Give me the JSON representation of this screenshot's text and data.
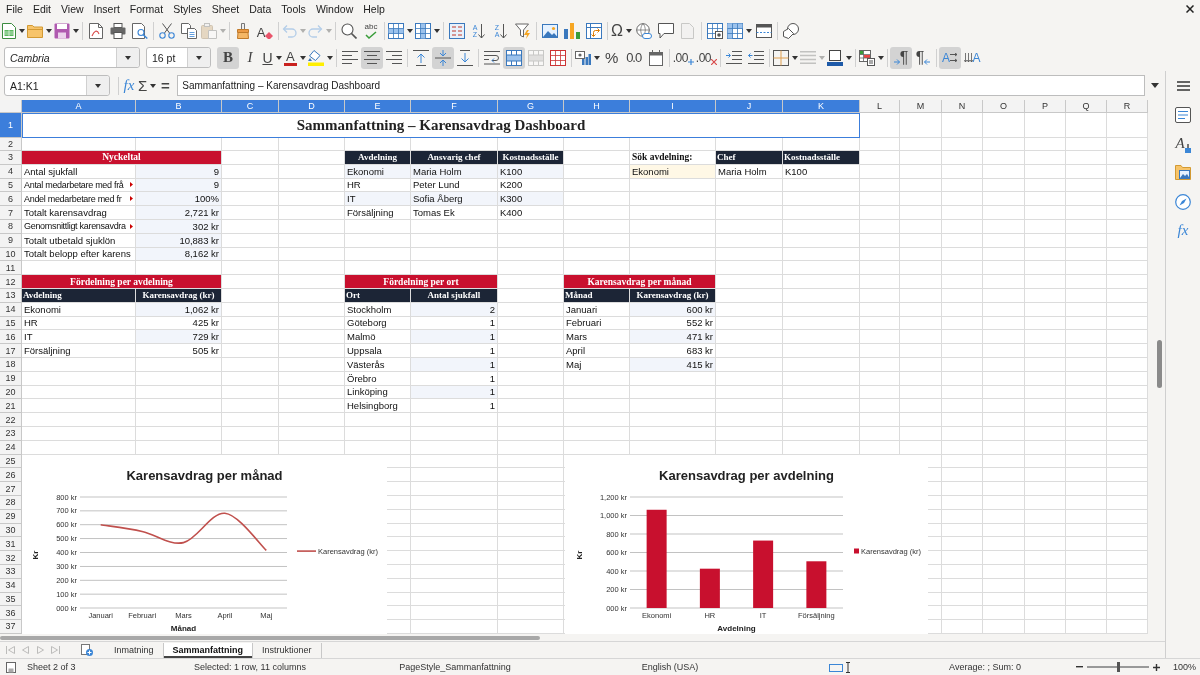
{
  "menu_bar": [
    "File",
    "Edit",
    "View",
    "Insert",
    "Format",
    "Styles",
    "Sheet",
    "Data",
    "Tools",
    "Window",
    "Help"
  ],
  "standard_toolbar": [
    [
      {
        "kind": "new",
        "dropdown": true,
        "disabled": false
      },
      {
        "kind": "open",
        "dropdown": true,
        "disabled": false
      },
      {
        "kind": "save",
        "dropdown": true,
        "disabled": false
      }
    ],
    [
      {
        "kind": "pdf",
        "dropdown": false,
        "disabled": false
      },
      {
        "kind": "print",
        "dropdown": false,
        "disabled": false
      },
      {
        "kind": "preview",
        "dropdown": false,
        "disabled": false
      }
    ],
    [
      {
        "kind": "cut",
        "dropdown": false,
        "disabled": false
      },
      {
        "kind": "copy",
        "dropdown": false,
        "disabled": false
      },
      {
        "kind": "paste",
        "dropdown": true,
        "disabled": true
      }
    ],
    [
      {
        "kind": "clone",
        "dropdown": false,
        "disabled": false
      },
      {
        "kind": "clear",
        "glyph": "A",
        "dropdown": false,
        "disabled": false
      }
    ],
    [
      {
        "kind": "undo",
        "dropdown": true,
        "disabled": true
      },
      {
        "kind": "redo",
        "dropdown": true,
        "disabled": true
      }
    ],
    [
      {
        "kind": "find",
        "dropdown": false,
        "disabled": false
      },
      {
        "kind": "spelling",
        "glyph": "abc",
        "dropdown": false,
        "disabled": false
      }
    ],
    [
      {
        "kind": "rows",
        "dropdown": true,
        "disabled": false
      },
      {
        "kind": "columns",
        "dropdown": true,
        "disabled": false
      }
    ],
    [
      {
        "kind": "sort",
        "dropdown": false,
        "disabled": false
      },
      {
        "kind": "sort_ascending",
        "glyph": "A Z",
        "dropdown": false,
        "disabled": false
      },
      {
        "kind": "sort_descending",
        "glyph": "Z A",
        "dropdown": false,
        "disabled": false
      },
      {
        "kind": "autofilter",
        "dropdown": false,
        "disabled": false
      }
    ],
    [
      {
        "kind": "image",
        "dropdown": false,
        "disabled": false
      },
      {
        "kind": "chart",
        "dropdown": false,
        "disabled": false
      },
      {
        "kind": "pivot_table",
        "dropdown": false,
        "disabled": false
      }
    ],
    [
      {
        "kind": "special_character",
        "glyph": "Ω",
        "dropdown": true,
        "disabled": false
      },
      {
        "kind": "hyperlink",
        "dropdown": false,
        "disabled": false
      },
      {
        "kind": "comment",
        "dropdown": false,
        "disabled": false
      },
      {
        "kind": "headers_footers",
        "dropdown": false,
        "disabled": true
      }
    ],
    [
      {
        "kind": "print_area",
        "dropdown": false,
        "disabled": false
      },
      {
        "kind": "freeze",
        "dropdown": true,
        "disabled": false
      },
      {
        "kind": "split_window",
        "dropdown": false,
        "disabled": false
      }
    ],
    [
      {
        "kind": "shapes",
        "dropdown": false,
        "disabled": false
      }
    ]
  ],
  "formatting_toolbar": {
    "font_name": "Cambria",
    "font_size": "16 pt",
    "groups": [
      [
        {
          "kind": "bold",
          "glyph": "B",
          "dropdown": false,
          "on": true,
          "disabled": false
        },
        {
          "kind": "italic",
          "glyph": "I",
          "dropdown": false,
          "on": false,
          "disabled": false
        },
        {
          "kind": "underline",
          "glyph": "U",
          "dropdown": true,
          "on": false,
          "disabled": false
        },
        {
          "kind": "font_color",
          "glyph": "A",
          "dropdown": true,
          "on": false,
          "disabled": false
        },
        {
          "kind": "highlight",
          "dropdown": true,
          "on": false,
          "disabled": false
        }
      ],
      [
        {
          "kind": "align_left",
          "dropdown": false,
          "on": false,
          "disabled": false
        },
        {
          "kind": "align_center",
          "dropdown": false,
          "on": true,
          "disabled": false
        },
        {
          "kind": "align_right",
          "dropdown": false,
          "on": false,
          "disabled": false
        }
      ],
      [
        {
          "kind": "align_top",
          "dropdown": false,
          "on": false,
          "disabled": false
        },
        {
          "kind": "align_middle",
          "dropdown": false,
          "on": true,
          "disabled": false
        },
        {
          "kind": "align_bottom",
          "dropdown": false,
          "on": false,
          "disabled": false
        }
      ],
      [
        {
          "kind": "wrap",
          "dropdown": false,
          "on": false,
          "disabled": false
        },
        {
          "kind": "merge_center",
          "dropdown": false,
          "on": true,
          "disabled": false
        },
        {
          "kind": "merge",
          "dropdown": false,
          "on": false,
          "disabled": true
        },
        {
          "kind": "unmerge",
          "dropdown": false,
          "on": false,
          "disabled": false
        }
      ],
      [
        {
          "kind": "currency",
          "dropdown": true,
          "on": false,
          "disabled": false
        },
        {
          "kind": "percent",
          "glyph": "%",
          "dropdown": false,
          "on": false,
          "disabled": false
        },
        {
          "kind": "number",
          "glyph": "0.0",
          "dropdown": false,
          "on": false,
          "disabled": false
        },
        {
          "kind": "date",
          "dropdown": false,
          "on": false,
          "disabled": false
        }
      ],
      [
        {
          "kind": "add_decimal",
          "glyph": ".00",
          "dropdown": false,
          "on": false,
          "disabled": false
        },
        {
          "kind": "delete_decimal",
          "glyph": ".00",
          "dropdown": false,
          "on": false,
          "disabled": false
        }
      ],
      [
        {
          "kind": "indent_increase",
          "dropdown": false,
          "on": false,
          "disabled": false
        },
        {
          "kind": "indent_decrease",
          "dropdown": false,
          "on": false,
          "disabled": false
        }
      ],
      [
        {
          "kind": "borders",
          "dropdown": true,
          "on": false,
          "disabled": false
        },
        {
          "kind": "border_style",
          "dropdown": true,
          "on": false,
          "disabled": true
        },
        {
          "kind": "border_color",
          "dropdown": true,
          "on": false,
          "disabled": false
        }
      ],
      [
        {
          "kind": "conditional",
          "dropdown": true,
          "on": false,
          "disabled": false
        }
      ],
      [
        {
          "kind": "ltr",
          "glyph": "¶",
          "dropdown": false,
          "on": true,
          "disabled": false
        },
        {
          "kind": "rtl",
          "glyph": "¶",
          "dropdown": false,
          "on": false,
          "disabled": false
        }
      ],
      [
        {
          "kind": "text_ltr",
          "glyph": "A",
          "dropdown": false,
          "on": true,
          "disabled": false
        },
        {
          "kind": "text_ttb",
          "glyph": "A",
          "dropdown": false,
          "on": false,
          "disabled": false
        }
      ]
    ]
  },
  "formula_bar": {
    "name_box": "A1:K1",
    "buttons": [
      {
        "kind": "function_wizard",
        "glyph": "fx",
        "dropdown": false
      },
      {
        "kind": "sum",
        "glyph": "Σ",
        "dropdown": true
      },
      {
        "kind": "formula",
        "glyph": "=",
        "dropdown": false
      }
    ],
    "content": "Sammanfattning – Karensavdrag Dashboard"
  },
  "sidebar": [
    {
      "kind": "properties"
    },
    {
      "kind": "styles",
      "glyph": "A"
    },
    {
      "kind": "gallery"
    },
    {
      "kind": "navigator"
    },
    {
      "kind": "functions",
      "glyph": "fx"
    }
  ],
  "sheet": {
    "columns": [
      {
        "label": "A",
        "selected": true
      },
      {
        "label": "B",
        "selected": true
      },
      {
        "label": "C",
        "selected": true
      },
      {
        "label": "D",
        "selected": true
      },
      {
        "label": "E",
        "selected": true
      },
      {
        "label": "F",
        "selected": true
      },
      {
        "label": "G",
        "selected": true
      },
      {
        "label": "H",
        "selected": true
      },
      {
        "label": "I",
        "selected": true
      },
      {
        "label": "J",
        "selected": true
      },
      {
        "label": "K",
        "selected": true
      },
      {
        "label": "L",
        "selected": false
      },
      {
        "label": "M",
        "selected": false
      },
      {
        "label": "N",
        "selected": false
      },
      {
        "label": "O",
        "selected": false
      },
      {
        "label": "P",
        "selected": false
      },
      {
        "label": "Q",
        "selected": false
      },
      {
        "label": "R",
        "selected": false
      }
    ],
    "rows": [
      {
        "label": "1",
        "selected": true
      },
      {
        "label": "2",
        "selected": false
      },
      {
        "label": "3",
        "selected": false
      },
      {
        "label": "4",
        "selected": false
      },
      {
        "label": "5",
        "selected": false
      },
      {
        "label": "6",
        "selected": false
      },
      {
        "label": "7",
        "selected": false
      },
      {
        "label": "8",
        "selected": false
      },
      {
        "label": "9",
        "selected": false
      },
      {
        "label": "10",
        "selected": false
      },
      {
        "label": "11",
        "selected": false
      },
      {
        "label": "12",
        "selected": false
      },
      {
        "label": "13",
        "selected": false
      },
      {
        "label": "14",
        "selected": false
      },
      {
        "label": "15",
        "selected": false
      },
      {
        "label": "16",
        "selected": false
      },
      {
        "label": "17",
        "selected": false
      },
      {
        "label": "18",
        "selected": false
      },
      {
        "label": "19",
        "selected": false
      },
      {
        "label": "20",
        "selected": false
      },
      {
        "label": "21",
        "selected": false
      },
      {
        "label": "22",
        "selected": false
      },
      {
        "label": "23",
        "selected": false
      },
      {
        "label": "24",
        "selected": false
      },
      {
        "label": "25",
        "selected": false
      },
      {
        "label": "26",
        "selected": false
      },
      {
        "label": "27",
        "selected": false
      },
      {
        "label": "28",
        "selected": false
      },
      {
        "label": "29",
        "selected": false
      },
      {
        "label": "30",
        "selected": false
      },
      {
        "label": "31",
        "selected": false
      },
      {
        "label": "32",
        "selected": false
      },
      {
        "label": "33",
        "selected": false
      },
      {
        "label": "34",
        "selected": false
      },
      {
        "label": "35",
        "selected": false
      },
      {
        "label": "36",
        "selected": false
      },
      {
        "label": "37",
        "selected": false
      }
    ],
    "title": "Sammanfattning – Karensavdrag Dashboard",
    "key_figures": {
      "title": "Nyckeltal",
      "rows": [
        {
          "label": "Antal sjukfall",
          "value": "9",
          "clipped": false
        },
        {
          "label": "Antal medarbetare med frå",
          "value": "9",
          "clipped": true
        },
        {
          "label": "Andel medarbetare med fr",
          "value": "100%",
          "clipped": true
        },
        {
          "label": "Totalt karensavdrag",
          "value": "2,721 kr",
          "clipped": false
        },
        {
          "label": "Genomsnittligt karensavdra",
          "value": "302 kr",
          "clipped": true
        },
        {
          "label": "Totalt utbetald sjuklön",
          "value": "10,883 kr",
          "clipped": false
        },
        {
          "label": "Totalt belopp efter karens",
          "value": "8,162 kr",
          "clipped": false
        }
      ]
    },
    "departments": {
      "columns": [
        "Avdelning",
        "Ansvarig chef",
        "Kostnadsställe"
      ],
      "rows": [
        [
          "Ekonomi",
          "Maria Holm",
          "K100"
        ],
        [
          "HR",
          "Peter Lund",
          "K200"
        ],
        [
          "IT",
          "Sofia Åberg",
          "K300"
        ],
        [
          "Försäljning",
          "Tomas Ek",
          "K400"
        ]
      ]
    },
    "lookup": {
      "label": "Sök avdelning:",
      "input": "Ekonomi",
      "columns": [
        "Chef",
        "Kostnadsställe"
      ],
      "result": [
        "Maria Holm",
        "K100"
      ]
    },
    "summaries": [
      {
        "title": "Fördelning per avdelning",
        "columns": [
          "Avdelning",
          "Karensavdrag (kr)"
        ],
        "rows": [
          [
            "Ekonomi",
            "1,062 kr"
          ],
          [
            "HR",
            "425 kr"
          ],
          [
            "IT",
            "729 kr"
          ],
          [
            "Försäljning",
            "505 kr"
          ]
        ]
      },
      {
        "title": "Fördelning per ort",
        "columns": [
          "Ort",
          "Antal sjukfall"
        ],
        "rows": [
          [
            "Stockholm",
            "2"
          ],
          [
            "Göteborg",
            "1"
          ],
          [
            "Malmö",
            "1"
          ],
          [
            "Uppsala",
            "1"
          ],
          [
            "Västerås",
            "1"
          ],
          [
            "Örebro",
            "1"
          ],
          [
            "Linköping",
            "1"
          ],
          [
            "Helsingborg",
            "1"
          ]
        ]
      },
      {
        "title": "Karensavdrag per månad",
        "columns": [
          "Månad",
          "Karensavdrag (kr)"
        ],
        "rows": [
          [
            "Januari",
            "600 kr"
          ],
          [
            "Februari",
            "552 kr"
          ],
          [
            "Mars",
            "471 kr"
          ],
          [
            "April",
            "683 kr"
          ],
          [
            "Maj",
            "415 kr"
          ]
        ]
      }
    ],
    "charts": [
      {
        "chart_data": {
          "type": "line",
          "title": "Karensavdrag per månad",
          "xlabel": "Månad",
          "ylabel": "Kr",
          "categories": [
            "Januari",
            "Februari",
            "Mars",
            "April",
            "Maj"
          ],
          "series": [
            {
              "name": "Karensavdrag (kr)",
              "color": "#c0504d",
              "values": [
                600,
                552,
                471,
                683,
                415
              ]
            }
          ],
          "ylim": [
            0,
            800
          ],
          "yticks": [
            {
              "value": 0,
              "label": "000 kr"
            },
            {
              "value": 100,
              "label": "100 kr"
            },
            {
              "value": 200,
              "label": "200 kr"
            },
            {
              "value": 300,
              "label": "300 kr"
            },
            {
              "value": 400,
              "label": "400 kr"
            },
            {
              "value": 500,
              "label": "500 kr"
            },
            {
              "value": 600,
              "label": "600 kr"
            },
            {
              "value": 700,
              "label": "700 kr"
            },
            {
              "value": 800,
              "label": "800 kr"
            }
          ]
        }
      },
      {
        "chart_data": {
          "type": "bar",
          "title": "Karensavdrag per avdelning",
          "xlabel": "Avdelning",
          "ylabel": "Kr",
          "categories": [
            "Ekonomi",
            "HR",
            "IT",
            "Försäljning"
          ],
          "series": [
            {
              "name": "Karensavdrag (kr)",
              "color": "#c8102e",
              "values": [
                1062,
                425,
                729,
                505
              ]
            }
          ],
          "ylim": [
            0,
            1200
          ],
          "yticks": [
            {
              "value": 0,
              "label": "000 kr"
            },
            {
              "value": 200,
              "label": "200 kr"
            },
            {
              "value": 400,
              "label": "400 kr"
            },
            {
              "value": 600,
              "label": "600 kr"
            },
            {
              "value": 800,
              "label": "800 kr"
            },
            {
              "value": 1000,
              "label": "1,000 kr"
            },
            {
              "value": 1200,
              "label": "1,200 kr"
            }
          ]
        }
      }
    ]
  },
  "sheet_navigation": [
    {
      "kind": "first",
      "disabled": true
    },
    {
      "kind": "prev",
      "disabled": true
    },
    {
      "kind": "next",
      "disabled": true
    },
    {
      "kind": "last",
      "disabled": true
    }
  ],
  "sheet_tabs": [
    {
      "label": "Inmatning",
      "selected": false
    },
    {
      "label": "Sammanfattning",
      "selected": true
    },
    {
      "label": "Instruktioner",
      "selected": false
    }
  ],
  "status_bar": {
    "sheet": "Sheet 2 of 3",
    "selection": "Selected: 1 row, 11 columns",
    "page_style": "PageStyle_Sammanfattning",
    "language": "English (USA)",
    "summary": "Average: ; Sum: 0",
    "zoom_slider": {
      "level": 0.5
    },
    "zoom": "100%"
  }
}
